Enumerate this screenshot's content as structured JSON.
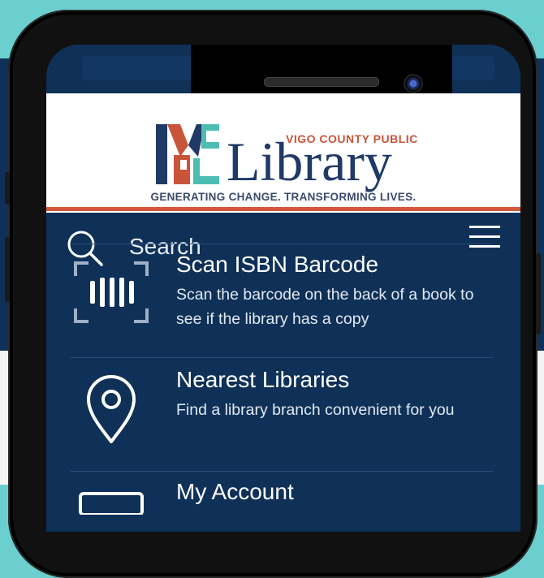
{
  "logo": {
    "small_text": "VIGO COUNTY PUBLIC",
    "name": "Library",
    "tagline": "GENERATING CHANGE. TRANSFORMING LIVES."
  },
  "search": {
    "label": "Search"
  },
  "menu": {
    "items": [
      {
        "title": "Scan ISBN Barcode",
        "description": "Scan the barcode on the back of a book to see if the library has a copy",
        "icon": "barcode-scan-icon"
      },
      {
        "title": "Nearest Libraries",
        "description": "Find a library branch convenient for you",
        "icon": "map-pin-icon"
      },
      {
        "title": "My Account",
        "description": "",
        "icon": "account-icon"
      }
    ]
  },
  "colors": {
    "navy": "#0f3158",
    "teal": "#6ccfcf",
    "accent": "#d4573a",
    "logo_blue": "#1f3a66"
  }
}
